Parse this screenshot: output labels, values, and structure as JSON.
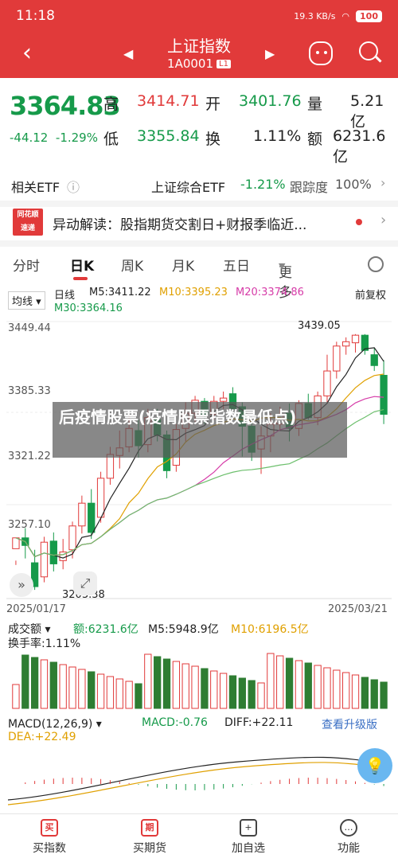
{
  "status": {
    "time": "11:18",
    "net": "19.3 KB/s",
    "battery": "100"
  },
  "nav": {
    "title": "上证指数",
    "code": "1A0001",
    "level": "L1"
  },
  "quote": {
    "price": "3364.83",
    "change": "-44.12",
    "pct": "-1.29%",
    "high_l": "高",
    "high": "3414.71",
    "open_l": "开",
    "open": "3401.76",
    "vol_l": "量",
    "vol": "5.21亿",
    "low_l": "低",
    "low": "3355.84",
    "turn_l": "换",
    "turn": "1.11%",
    "amt_l": "额",
    "amt": "6231.6亿"
  },
  "etf": {
    "label": "相关ETF",
    "name": "上证综合ETF",
    "pct": "-1.21%",
    "track_l": "跟踪度",
    "track": "100%"
  },
  "news": {
    "logo1": "同花顺",
    "logo2": "速递",
    "text": "异动解读：股指期货交割日+财报季临近..."
  },
  "tabs": [
    "分时",
    "日K",
    "周K",
    "月K",
    "五日",
    "更多"
  ],
  "kline": {
    "ma_btn": "均线",
    "period": "日线",
    "m5": "M5:3411.22",
    "m10": "M10:3395.23",
    "m20": "M20:3374.86",
    "m30": "M30:3364.16",
    "adj": "前复权",
    "y1": "3449.44",
    "y2": "3385.33",
    "y3": "3321.22",
    "y4": "3257.10",
    "max": "3439.05",
    "min": "3203.38",
    "d1": "2025/01/17",
    "d2": "2025/03/21"
  },
  "vol": {
    "label": "成交额",
    "val": "额:6231.6亿",
    "m5": "M5:5948.9亿",
    "m10": "M10:6196.5亿",
    "turn": "换手率:1.11%"
  },
  "macd": {
    "label": "MACD(12,26,9)",
    "macd": "MACD:-0.76",
    "diff": "DIFF:+22.11",
    "dea": "DEA:+22.49",
    "upgrade": "查看升级版"
  },
  "overlay": "后疫情股票(疫情股票指数最低点)",
  "bottom": [
    {
      "icon": "买",
      "label": "买指数"
    },
    {
      "icon": "期",
      "label": "买期货"
    },
    {
      "icon": "+",
      "label": "加自选"
    },
    {
      "icon": "…",
      "label": "功能"
    }
  ],
  "chart_data": {
    "type": "candlestick",
    "x_range": [
      "2025/01/17",
      "2025/03/21"
    ],
    "candles": [
      [
        3241,
        3251,
        3230,
        3226
      ],
      [
        3251,
        3244,
        3260,
        3232
      ],
      [
        3228,
        3206,
        3240,
        3203
      ],
      [
        3215,
        3247,
        3252,
        3210
      ],
      [
        3248,
        3227,
        3256,
        3220
      ],
      [
        3230,
        3238,
        3250,
        3222
      ],
      [
        3240,
        3262,
        3266,
        3232
      ],
      [
        3262,
        3283,
        3290,
        3255
      ],
      [
        3283,
        3256,
        3296,
        3250
      ],
      [
        3270,
        3306,
        3312,
        3265
      ],
      [
        3306,
        3328,
        3335,
        3300
      ],
      [
        3327,
        3334,
        3350,
        3315
      ],
      [
        3335,
        3352,
        3365,
        3330
      ],
      [
        3350,
        3336,
        3360,
        3325
      ],
      [
        3337,
        3362,
        3370,
        3330
      ],
      [
        3360,
        3346,
        3370,
        3340
      ],
      [
        3346,
        3313,
        3350,
        3306
      ],
      [
        3318,
        3351,
        3356,
        3312
      ],
      [
        3352,
        3366,
        3376,
        3340
      ],
      [
        3366,
        3378,
        3382,
        3358
      ],
      [
        3377,
        3365,
        3380,
        3356
      ],
      [
        3365,
        3377,
        3382,
        3360
      ],
      [
        3377,
        3380,
        3386,
        3370
      ],
      [
        3384,
        3370,
        3390,
        3368
      ],
      [
        3372,
        3354,
        3376,
        3326
      ],
      [
        3354,
        3330,
        3358,
        3322
      ],
      [
        3333,
        3345,
        3354,
        3310
      ],
      [
        3345,
        3356,
        3366,
        3330
      ],
      [
        3356,
        3365,
        3372,
        3350
      ],
      [
        3366,
        3352,
        3375,
        3340
      ],
      [
        3352,
        3375,
        3378,
        3345
      ],
      [
        3375,
        3362,
        3384,
        3360
      ],
      [
        3362,
        3382,
        3386,
        3355
      ],
      [
        3382,
        3405,
        3420,
        3376
      ],
      [
        3405,
        3428,
        3432,
        3398
      ],
      [
        3428,
        3432,
        3436,
        3420
      ],
      [
        3431,
        3438,
        3439,
        3422
      ],
      [
        3438,
        3424,
        3439,
        3420
      ],
      [
        3420,
        3410,
        3426,
        3405
      ],
      [
        3401,
        3365,
        3415,
        3356
      ]
    ]
  }
}
